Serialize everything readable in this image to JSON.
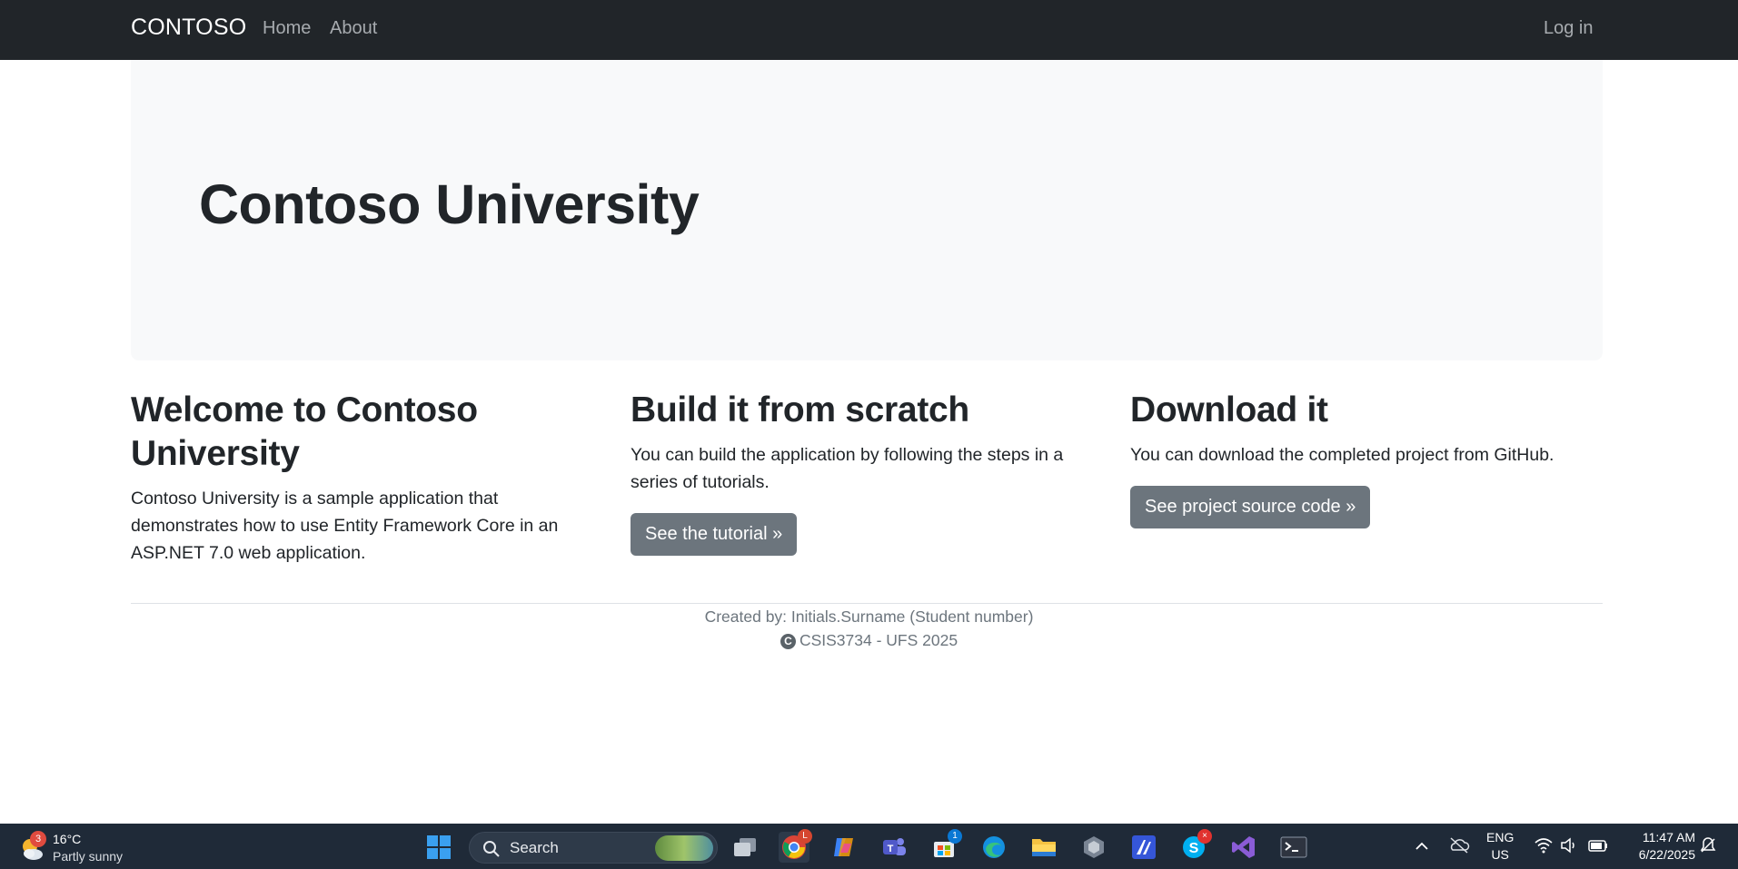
{
  "navbar": {
    "brand": "CONTOSO",
    "links": [
      "Home",
      "About"
    ],
    "login": "Log in"
  },
  "hero": {
    "title": "Contoso University"
  },
  "columns": [
    {
      "heading": "Welcome to Contoso University",
      "text": "Contoso University is a sample application that demonstrates how to use Entity Framework Core in an ASP.NET 7.0 web application.",
      "button": null
    },
    {
      "heading": "Build it from scratch",
      "text": "You can build the application by following the steps in a series of tutorials.",
      "button": "See the tutorial »"
    },
    {
      "heading": "Download it",
      "text": "You can download the completed project from GitHub.",
      "button": "See project source code »"
    }
  ],
  "footer": {
    "line1": "Created by: Initials.Surname (Student number)",
    "copyright_symbol": "C",
    "line2": "CSIS3734 - UFS 2025"
  },
  "taskbar": {
    "weather": {
      "badge": "3",
      "temp": "16°C",
      "desc": "Partly sunny"
    },
    "search_label": "Search",
    "chrome_badge": "L",
    "store_badge": "1",
    "language": {
      "line1": "ENG",
      "line2": "US"
    },
    "clock": {
      "time": "11:47 AM",
      "date": "6/22/2025"
    },
    "colors": {
      "bar": "#1f2a38",
      "accent": "#0078d4"
    }
  }
}
